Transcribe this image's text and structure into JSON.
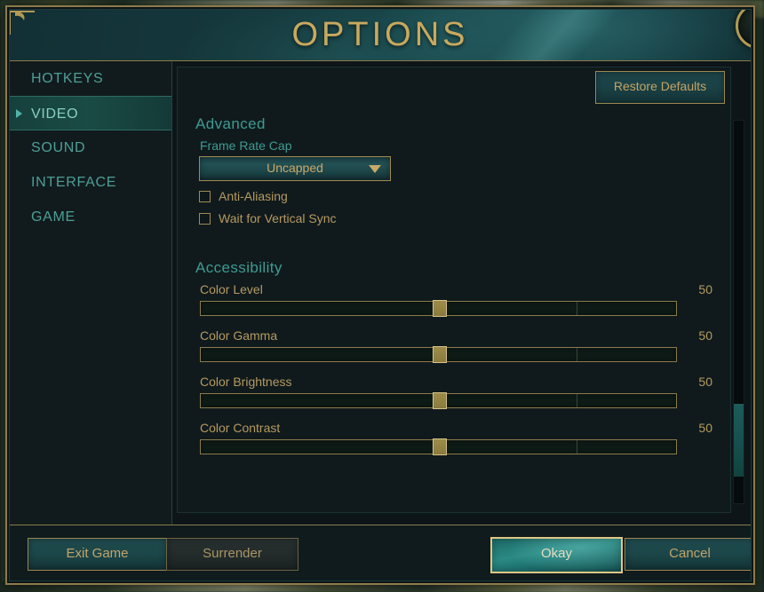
{
  "window": {
    "title": "OPTIONS",
    "close_icon": "close-icon",
    "close_glyph": "✕"
  },
  "sidebar": {
    "items": [
      {
        "label": "HOTKEYS",
        "selected": false
      },
      {
        "label": "VIDEO",
        "selected": true
      },
      {
        "label": "SOUND",
        "selected": false
      },
      {
        "label": "INTERFACE",
        "selected": false
      },
      {
        "label": "GAME",
        "selected": false
      }
    ]
  },
  "content": {
    "restore_defaults_label": "Restore Defaults",
    "sections": {
      "advanced": {
        "heading": "Advanced",
        "frame_rate_cap": {
          "label": "Frame Rate Cap",
          "value": "Uncapped",
          "caret_icon": "chevron-down-icon"
        },
        "checkboxes": [
          {
            "label": "Anti-Aliasing",
            "checked": false
          },
          {
            "label": "Wait for Vertical Sync",
            "checked": false
          }
        ]
      },
      "accessibility": {
        "heading": "Accessibility",
        "sliders": [
          {
            "label": "Color Level",
            "value": "50",
            "percent": 50,
            "min": 0,
            "max": 100
          },
          {
            "label": "Color Gamma",
            "value": "50",
            "percent": 50,
            "min": 0,
            "max": 100
          },
          {
            "label": "Color Brightness",
            "value": "50",
            "percent": 50,
            "min": 0,
            "max": 100
          },
          {
            "label": "Color Contrast",
            "value": "50",
            "percent": 50,
            "min": 0,
            "max": 100
          }
        ]
      }
    }
  },
  "footer": {
    "exit_game_label": "Exit Game",
    "surrender_label": "Surrender",
    "okay_label": "Okay",
    "cancel_label": "Cancel"
  },
  "colors": {
    "gold_border": "#8d7b4b",
    "gold_text": "#c9a96a",
    "teal_heading": "#3e9b92",
    "teal_nav": "#4e9f96",
    "panel_bg": "#101a1d",
    "selected_nav_bg": "#1a4b45",
    "primary_button": "#2a8a84"
  }
}
